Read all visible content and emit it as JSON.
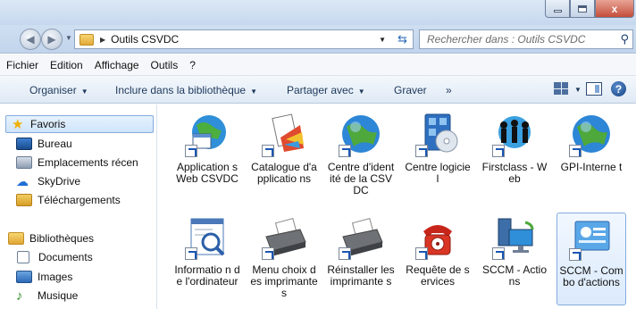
{
  "window": {
    "close_symbol": "x"
  },
  "address": {
    "segment": "Outils CSVDC"
  },
  "search": {
    "placeholder": "Rechercher dans : Outils CSVDC"
  },
  "menu": [
    "Fichier",
    "Edition",
    "Affichage",
    "Outils",
    "?"
  ],
  "commands": {
    "organize": "Organiser",
    "include": "Inclure dans la bibliothèque",
    "share": "Partager avec",
    "burn": "Graver",
    "more": "»",
    "help": "?"
  },
  "sidebar": {
    "favorites": "Favoris",
    "items": [
      "Bureau",
      "Emplacements récen",
      "SkyDrive",
      "Téléchargements"
    ],
    "libraries": "Bibliothèques",
    "lib_items": [
      "Documents",
      "Images",
      "Musique"
    ]
  },
  "files": [
    {
      "label": "Application s Web CSVDC",
      "icon": "globe-window-icon"
    },
    {
      "label": "Catalogue d'applicatio ns",
      "icon": "catalog-palette-icon"
    },
    {
      "label": "Centre d'identité de la CSVDC",
      "icon": "globe-icon"
    },
    {
      "label": "Centre logiciel",
      "icon": "software-center-icon"
    },
    {
      "label": "Firstclass - Web",
      "icon": "firstclass-globe-icon"
    },
    {
      "label": "GPI-Interne t",
      "icon": "globe-icon"
    },
    {
      "label": "Informatio n de l'ordinateur",
      "icon": "system-info-icon"
    },
    {
      "label": "Menu choix des imprimante s",
      "icon": "printer-icon"
    },
    {
      "label": "Réinstaller les imprimante s",
      "icon": "printer-icon"
    },
    {
      "label": "Requête de services",
      "icon": "telephone-icon"
    },
    {
      "label": "SCCM - Actions",
      "icon": "computer-network-icon"
    },
    {
      "label": "SCCM - Combo d'actions",
      "icon": "sccm-combo-icon"
    }
  ]
}
